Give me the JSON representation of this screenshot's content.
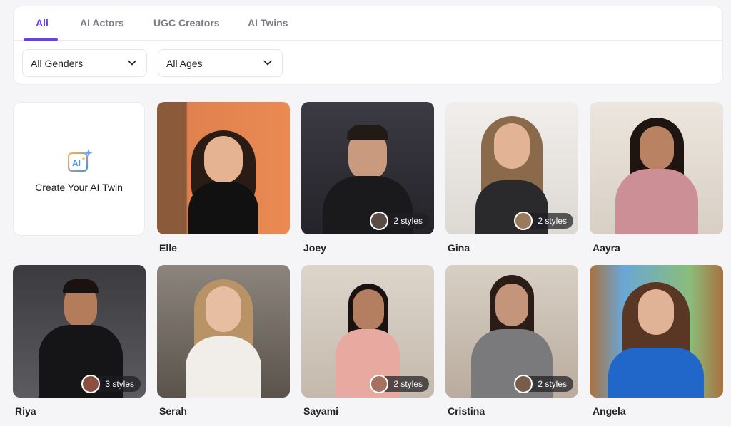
{
  "tabs": [
    {
      "label": "All",
      "active": true
    },
    {
      "label": "AI Actors"
    },
    {
      "label": "UGC Creators"
    },
    {
      "label": "AI Twins"
    }
  ],
  "filters": {
    "gender": "All Genders",
    "age": "All Ages"
  },
  "create": {
    "label": "Create Your AI Twin",
    "icon": "ai-sparkle-icon"
  },
  "avatars": [
    {
      "name": "Elle",
      "styles": ""
    },
    {
      "name": "Joey",
      "styles": "2 styles"
    },
    {
      "name": "Gina",
      "styles": "2 styles"
    },
    {
      "name": "Aayra",
      "styles": ""
    },
    {
      "name": "Riya",
      "styles": "3 styles"
    },
    {
      "name": "Serah",
      "styles": ""
    },
    {
      "name": "Sayami",
      "styles": "2 styles"
    },
    {
      "name": "Cristina",
      "styles": "2 styles"
    },
    {
      "name": "Angela",
      "styles": ""
    }
  ],
  "colors": {
    "accent": "#6b3df2"
  }
}
